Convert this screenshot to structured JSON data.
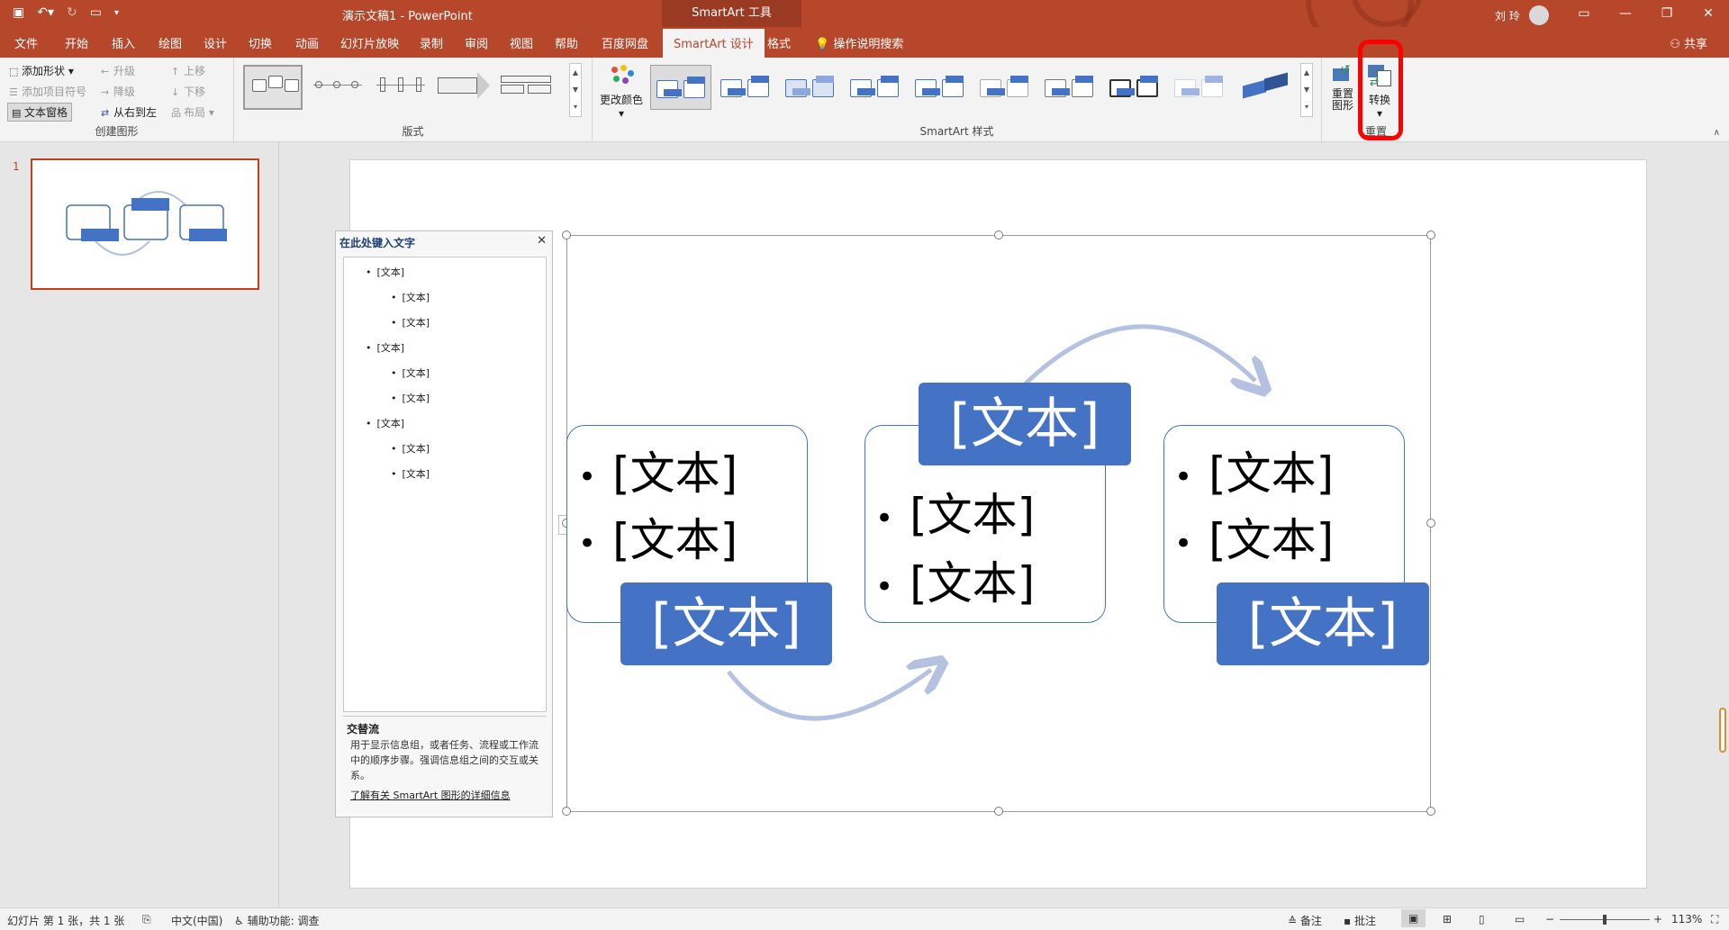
{
  "titlebar": {
    "title": "演示文稿1 - PowerPoint",
    "contextual_tab_group": "SmartArt 工具",
    "user": "刘 玲"
  },
  "tabs": [
    "文件",
    "开始",
    "插入",
    "绘图",
    "设计",
    "切换",
    "动画",
    "幻灯片放映",
    "录制",
    "审阅",
    "视图",
    "帮助",
    "百度网盘",
    "SmartArt 设计",
    "格式"
  ],
  "active_tab": "SmartArt 设计",
  "tell_me": "操作说明搜索",
  "share": "共享",
  "ribbon": {
    "create_graphic": {
      "label": "创建图形",
      "add_shape": "添加形状",
      "add_bullet": "添加项目符号",
      "text_pane": "文本窗格",
      "promote": "升级",
      "demote": "降级",
      "right_to_left": "从右到左",
      "move_up": "上移",
      "move_down": "下移",
      "layout": "布局"
    },
    "layouts": {
      "label": "版式"
    },
    "smartart_styles": {
      "label": "SmartArt 样式",
      "change_colors": "更改颜色"
    },
    "reset": {
      "label": "重置",
      "reset_graphic": "重置图形",
      "convert": "转换"
    }
  },
  "slides": {
    "current_number": "1"
  },
  "text_pane": {
    "title": "在此处键入文字",
    "items": [
      {
        "level": 1,
        "text": "[文本]"
      },
      {
        "level": 2,
        "text": "[文本]"
      },
      {
        "level": 2,
        "text": "[文本]"
      },
      {
        "level": 1,
        "text": "[文本]"
      },
      {
        "level": 2,
        "text": "[文本]"
      },
      {
        "level": 2,
        "text": "[文本]"
      },
      {
        "level": 1,
        "text": "[文本]"
      },
      {
        "level": 2,
        "text": "[文本]"
      },
      {
        "level": 2,
        "text": "[文本]"
      }
    ],
    "description_title": "交替流",
    "description": "用于显示信息组，或者任务、流程或工作流中的顺序步骤。强调信息组之间的交互或关系。",
    "learn_more": "了解有关 SmartArt 图形的详细信息"
  },
  "smartart": {
    "placeholder": "[文本]",
    "accent_color": "#4472c4",
    "arrow_color": "#b4c1e0"
  },
  "statusbar": {
    "slide_info": "幻灯片 第 1 张，共 1 张",
    "language": "中文(中国)",
    "accessibility": "辅助功能: 调查",
    "notes": "备注",
    "comments": "批注",
    "zoom": "113%"
  },
  "colors": {
    "titlebar": "#b7472a",
    "highlight": "#ff0000"
  }
}
